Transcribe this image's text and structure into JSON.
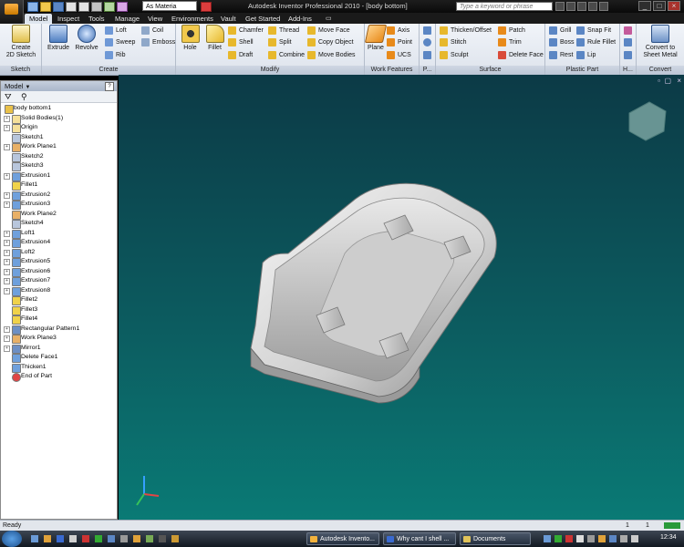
{
  "titlebar": {
    "material": "As Materia",
    "app_title": "Autodesk Inventor Professional 2010 - [body bottom]",
    "search_placeholder": "Type a keyword or phrase"
  },
  "tabs": [
    "Model",
    "Inspect",
    "Tools",
    "Manage",
    "View",
    "Environments",
    "Vault",
    "Get Started",
    "Add-Ins"
  ],
  "ribbon": {
    "sketch": {
      "create_2d_sketch": "Create\n2D Sketch",
      "panel": "Sketch"
    },
    "create": {
      "extrude": "Extrude",
      "revolve": "Revolve",
      "loft": "Loft",
      "sweep": "Sweep",
      "rib": "Rib",
      "coil": "Coil",
      "emboss": "Emboss",
      "panel": "Create"
    },
    "modify": {
      "hole": "Hole",
      "fillet": "Fillet",
      "chamfer": "Chamfer",
      "shell": "Shell",
      "draft": "Draft",
      "thread": "Thread",
      "split": "Split",
      "combine": "Combine",
      "move_face": "Move Face",
      "copy_object": "Copy Object",
      "move_bodies": "Move Bodies",
      "panel": "Modify"
    },
    "work_features": {
      "plane": "Plane",
      "axis": "Axis",
      "point": "Point",
      "ucs": "UCS",
      "panel": "Work Features"
    },
    "pattern": {
      "panel": "P..."
    },
    "surface": {
      "thicken_offset": "Thicken/Offset",
      "stitch": "Stitch",
      "sculpt": "Sculpt",
      "patch": "Patch",
      "trim": "Trim",
      "delete_face": "Delete Face",
      "panel": "Surface"
    },
    "plastic_part": {
      "grill": "Grill",
      "boss": "Boss",
      "rest": "Rest",
      "snap_fit": "Snap Fit",
      "rule_fillet": "Rule Fillet",
      "lip": "Lip",
      "panel": "Plastic Part"
    },
    "harness": {
      "panel": "H..."
    },
    "convert": {
      "convert_sheet_metal": "Convert to\nSheet Metal",
      "panel": "Convert"
    }
  },
  "browser": {
    "title": "Model",
    "items": [
      "body bottom1",
      "Solid Bodies(1)",
      "Origin",
      "Sketch1",
      "Work Plane1",
      "Sketch2",
      "Sketch3",
      "Extrusion1",
      "Fillet1",
      "Extrusion2",
      "Extrusion3",
      "Work Plane2",
      "Sketch4",
      "Loft1",
      "Extrusion4",
      "Loft2",
      "Extrusion5",
      "Extrusion6",
      "Extrusion7",
      "Extrusion8",
      "Fillet2",
      "Fillet3",
      "Fillet4",
      "Rectangular Pattern1",
      "Work Plane3",
      "Mirror1",
      "Delete Face1",
      "Thicken1",
      "End of Part"
    ]
  },
  "status": {
    "text": "Ready",
    "count_a": "1",
    "count_b": "1"
  },
  "taskbar": {
    "items": [
      "Autodesk Invento...",
      "Why cant I shell ...",
      "Documents"
    ],
    "clock": "12:34"
  },
  "colors": {
    "viewport_top": "#0c3a46",
    "viewport_bottom": "#0a7a75",
    "ribbon": "#e8edf4"
  }
}
